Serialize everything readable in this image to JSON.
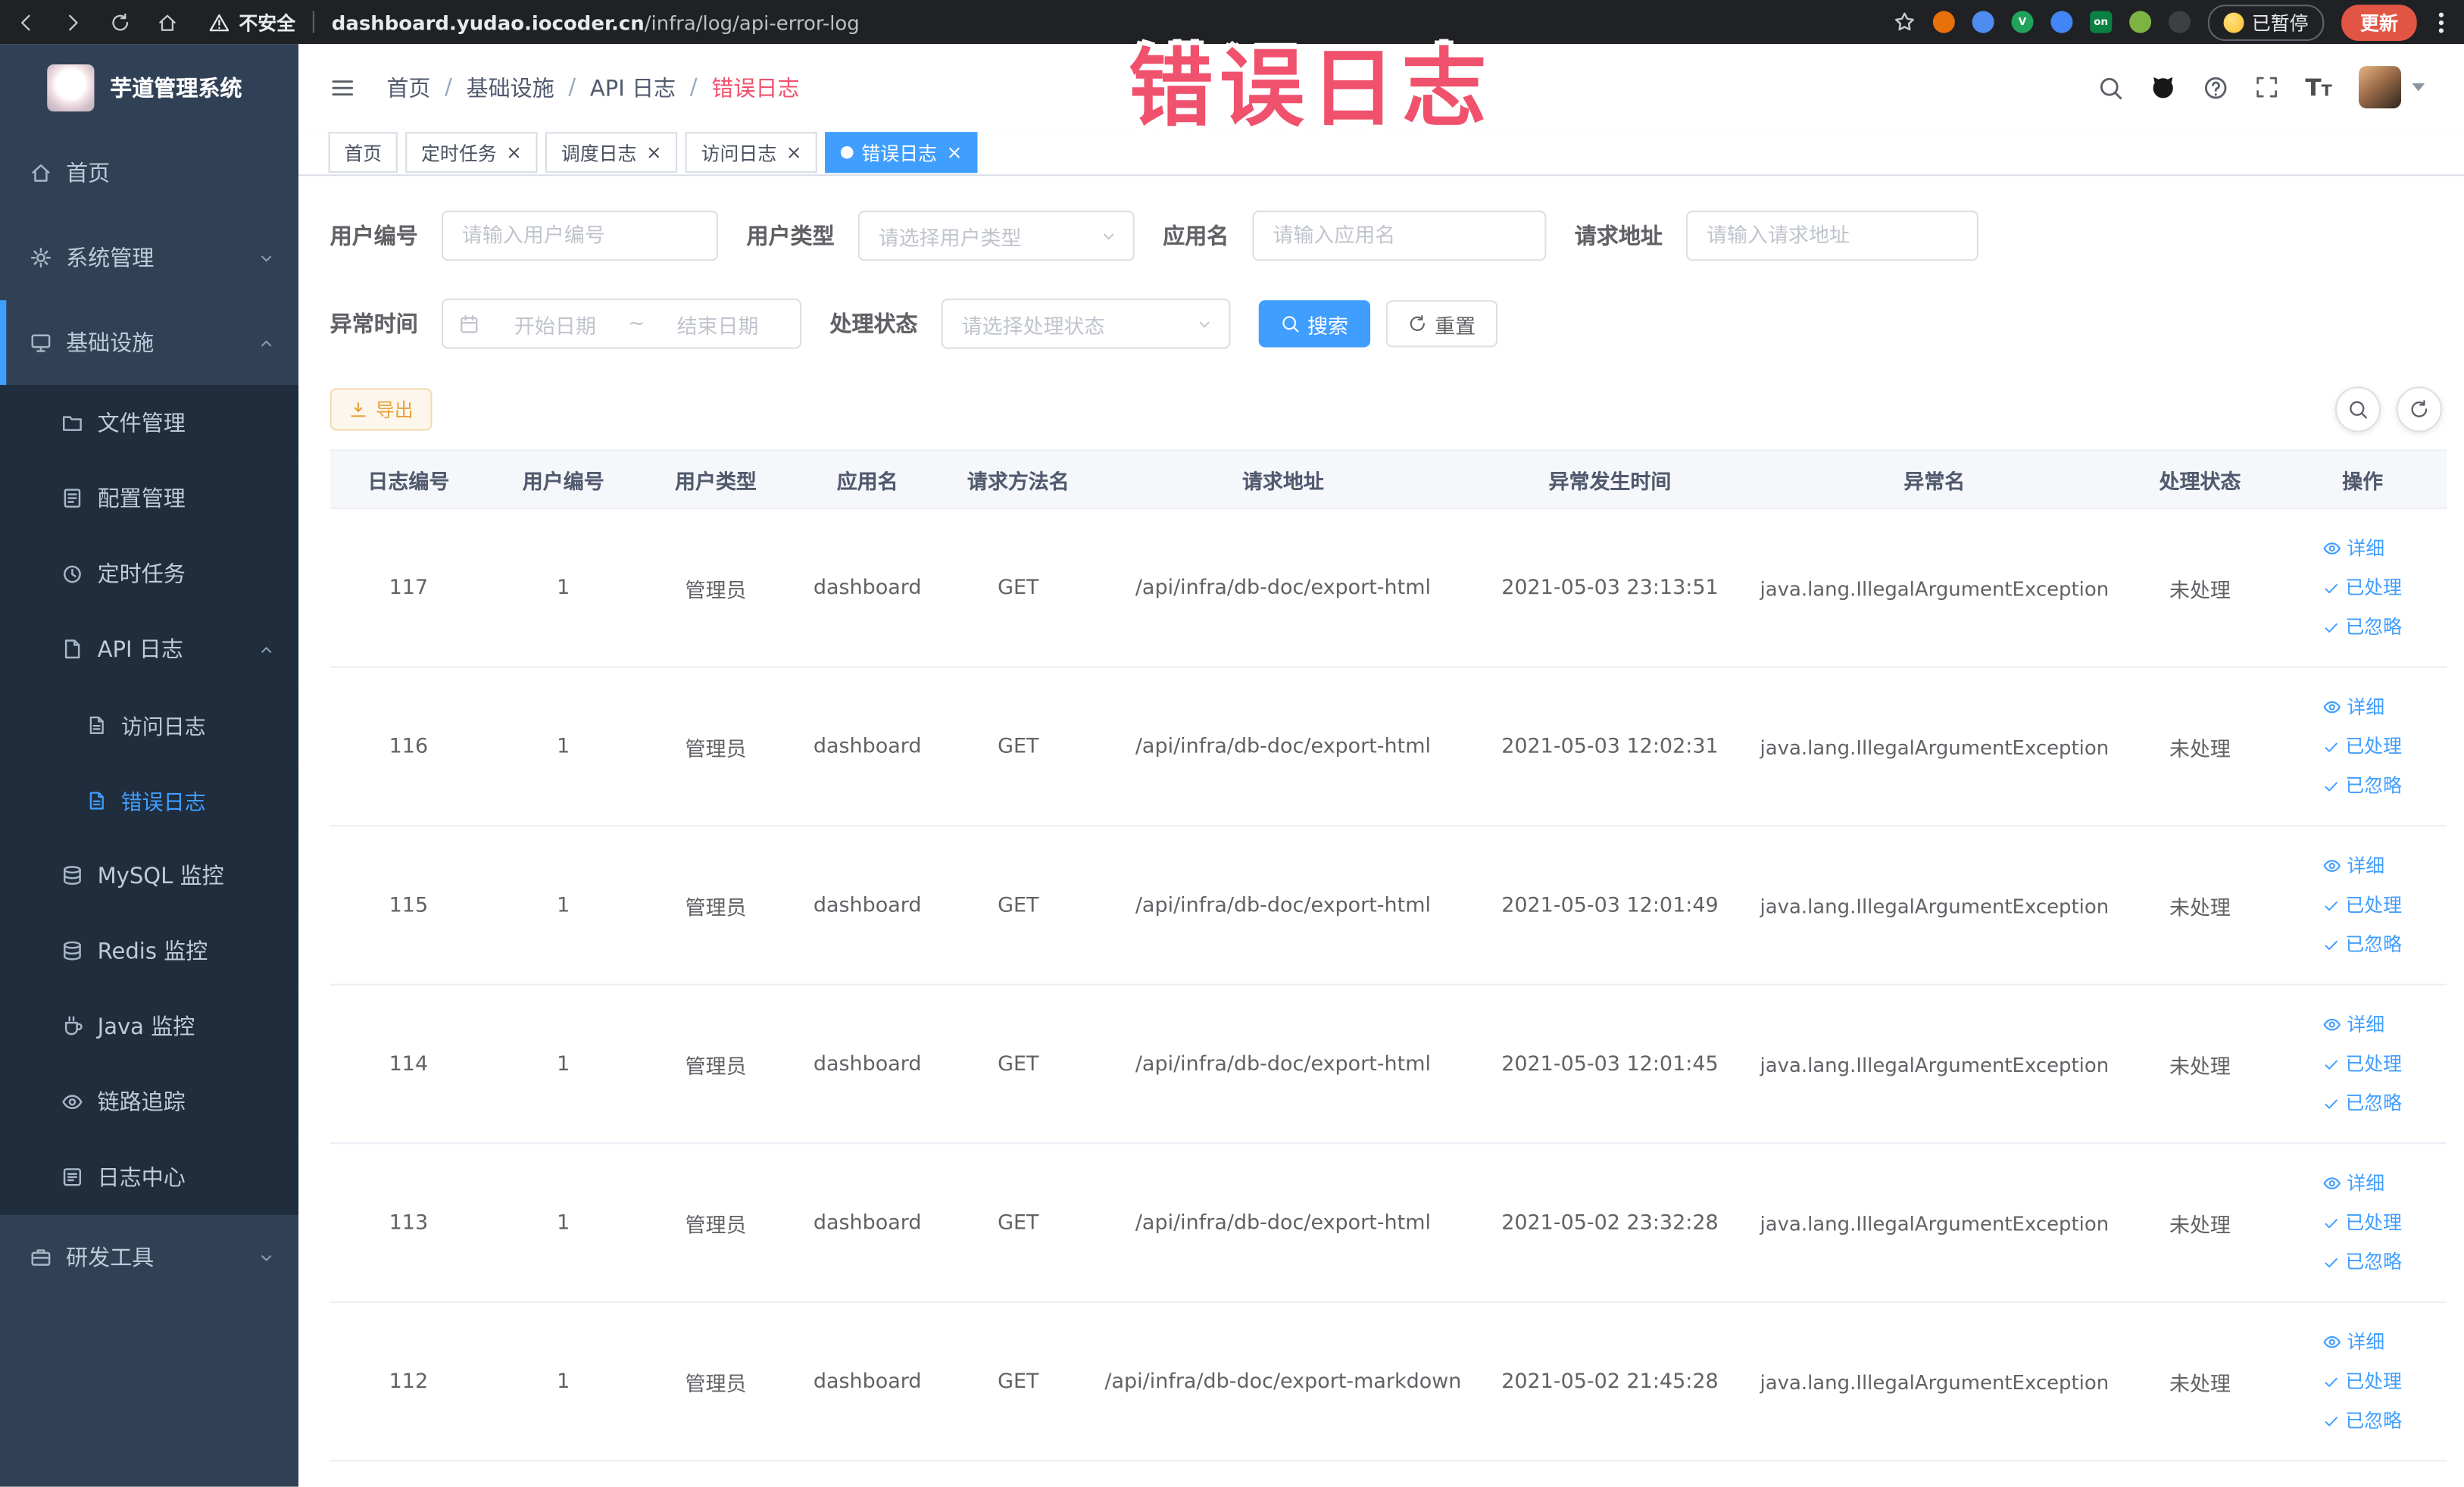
{
  "browser": {
    "security_label": "不安全",
    "url_domain": "dashboard.yudao.iocoder.cn",
    "url_path": "/infra/log/api-error-log",
    "paused_badge": "已暂停",
    "update_button": "更新",
    "extensions": [
      {
        "name": "extension-orange",
        "color": "#e8710a",
        "letter": ""
      },
      {
        "name": "extension-blue-drop",
        "color": "#4e8cf0",
        "letter": ""
      },
      {
        "name": "extension-green-v",
        "color": "#21a35a",
        "letter": "V"
      },
      {
        "name": "extension-blue-grid",
        "color": "#4285f4",
        "letter": ""
      },
      {
        "name": "extension-on-badge",
        "color": "#0b8043",
        "letter": "on"
      },
      {
        "name": "extension-green",
        "color": "#7cb342",
        "letter": ""
      },
      {
        "name": "extension-dark",
        "color": "#3c4043",
        "letter": ""
      }
    ]
  },
  "annotation": {
    "text": "错误日志",
    "color": "#f0516d"
  },
  "sidebar": {
    "app_title": "芋道管理系统",
    "menu": [
      {
        "name": "home",
        "label": "首页",
        "level": 0,
        "icon": "home-icon"
      },
      {
        "name": "system-management",
        "label": "系统管理",
        "level": 0,
        "icon": "gear-icon",
        "chevron": "down"
      },
      {
        "name": "infrastructure",
        "label": "基础设施",
        "level": 0,
        "icon": "infrastructure-icon",
        "chevron": "up",
        "accent": true
      },
      {
        "name": "file-management",
        "label": "文件管理",
        "level": 1,
        "icon": "file-icon"
      },
      {
        "name": "config-management",
        "label": "配置管理",
        "level": 1,
        "icon": "config-icon"
      },
      {
        "name": "scheduled-tasks",
        "label": "定时任务",
        "level": 1,
        "icon": "timer-icon"
      },
      {
        "name": "api-logs",
        "label": "API 日志",
        "level": 1,
        "icon": "api-log-icon",
        "chevron": "up"
      },
      {
        "name": "access-log",
        "label": "访问日志",
        "level": 2,
        "icon": "access-log-icon"
      },
      {
        "name": "error-log",
        "label": "错误日志",
        "level": 2,
        "icon": "error-log-icon",
        "active": true
      },
      {
        "name": "mysql-monitor",
        "label": "MySQL 监控",
        "level": 1,
        "icon": "mysql-icon"
      },
      {
        "name": "redis-monitor",
        "label": "Redis 监控",
        "level": 1,
        "icon": "redis-icon"
      },
      {
        "name": "java-monitor",
        "label": "Java 监控",
        "level": 1,
        "icon": "java-icon"
      },
      {
        "name": "trace",
        "label": "链路追踪",
        "level": 1,
        "icon": "trace-icon"
      },
      {
        "name": "log-center",
        "label": "日志中心",
        "level": 1,
        "icon": "log-center-icon"
      },
      {
        "name": "dev-tools",
        "label": "研发工具",
        "level": 0,
        "icon": "tools-icon",
        "chevron": "down"
      }
    ]
  },
  "header": {
    "breadcrumb": [
      "首页",
      "基础设施",
      "API 日志",
      "错误日志"
    ]
  },
  "tabs": [
    {
      "name": "home",
      "label": "首页",
      "closable": false,
      "active": false
    },
    {
      "name": "scheduled-tasks",
      "label": "定时任务",
      "closable": true,
      "active": false
    },
    {
      "name": "schedule-log",
      "label": "调度日志",
      "closable": true,
      "active": false
    },
    {
      "name": "access-log",
      "label": "访问日志",
      "closable": true,
      "active": false
    },
    {
      "name": "error-log",
      "label": "错误日志",
      "closable": true,
      "active": true
    }
  ],
  "filters": {
    "user_id": {
      "label": "用户编号",
      "placeholder": "请输入用户编号"
    },
    "user_type": {
      "label": "用户类型",
      "placeholder": "请选择用户类型"
    },
    "app_name": {
      "label": "应用名",
      "placeholder": "请输入应用名"
    },
    "request_url": {
      "label": "请求地址",
      "placeholder": "请输入请求地址"
    },
    "exception_time": {
      "label": "异常时间",
      "start_placeholder": "开始日期",
      "separator": "~",
      "end_placeholder": "结束日期"
    },
    "process_status": {
      "label": "处理状态",
      "placeholder": "请选择处理状态"
    },
    "search_button": "搜索",
    "reset_button": "重置"
  },
  "toolbar": {
    "export_label": "导出"
  },
  "table": {
    "columns": [
      "日志编号",
      "用户编号",
      "用户类型",
      "应用名",
      "请求方法名",
      "请求地址",
      "异常发生时间",
      "异常名",
      "处理状态",
      "操作"
    ],
    "action_labels": {
      "detail": "详细",
      "process": "已处理",
      "ignore": "已忽略"
    },
    "rows": [
      {
        "log_id": "117",
        "user_id": "1",
        "user_type": "管理员",
        "app_name": "dashboard",
        "method": "GET",
        "url": "/api/infra/db-doc/export-html",
        "time": "2021-05-03 23:13:51",
        "exception": "java.lang.IllegalArgumentException",
        "status": "未处理"
      },
      {
        "log_id": "116",
        "user_id": "1",
        "user_type": "管理员",
        "app_name": "dashboard",
        "method": "GET",
        "url": "/api/infra/db-doc/export-html",
        "time": "2021-05-03 12:02:31",
        "exception": "java.lang.IllegalArgumentException",
        "status": "未处理"
      },
      {
        "log_id": "115",
        "user_id": "1",
        "user_type": "管理员",
        "app_name": "dashboard",
        "method": "GET",
        "url": "/api/infra/db-doc/export-html",
        "time": "2021-05-03 12:01:49",
        "exception": "java.lang.IllegalArgumentException",
        "status": "未处理"
      },
      {
        "log_id": "114",
        "user_id": "1",
        "user_type": "管理员",
        "app_name": "dashboard",
        "method": "GET",
        "url": "/api/infra/db-doc/export-html",
        "time": "2021-05-03 12:01:45",
        "exception": "java.lang.IllegalArgumentException",
        "status": "未处理"
      },
      {
        "log_id": "113",
        "user_id": "1",
        "user_type": "管理员",
        "app_name": "dashboard",
        "method": "GET",
        "url": "/api/infra/db-doc/export-html",
        "time": "2021-05-02 23:32:28",
        "exception": "java.lang.IllegalArgumentException",
        "status": "未处理"
      },
      {
        "log_id": "112",
        "user_id": "1",
        "user_type": "管理员",
        "app_name": "dashboard",
        "method": "GET",
        "url": "/api/infra/db-doc/export-markdown",
        "time": "2021-05-02 21:45:28",
        "exception": "java.lang.IllegalArgumentException",
        "status": "未处理"
      }
    ]
  },
  "colors": {
    "primary": "#409eff",
    "warning": "#e6a23c",
    "annotation_highlight": "#f0516d",
    "sidebar_bg": "#304156",
    "submenu_bg": "#1f2d3d"
  }
}
